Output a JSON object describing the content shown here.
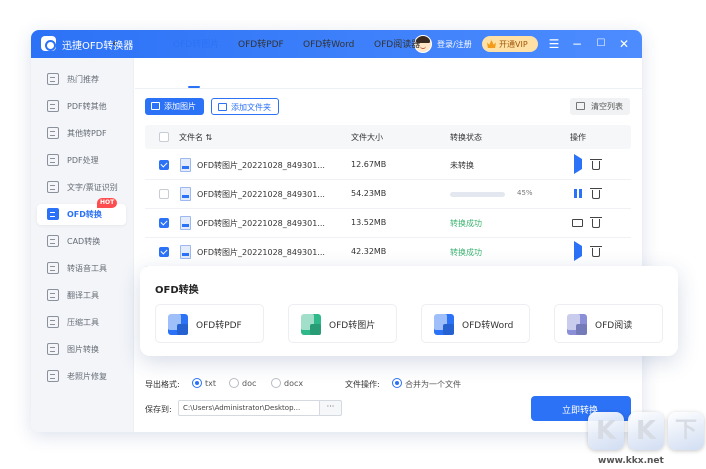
{
  "app": {
    "title": "迅捷OFD转换器",
    "login_text": "登录/注册",
    "vip_label": "开通VIP",
    "window_controls": [
      "menu-icon",
      "minimize-icon",
      "maximize-icon",
      "close-icon"
    ]
  },
  "sidebar": {
    "items": [
      {
        "label": "热门推荐",
        "icon": "star-icon",
        "active": false
      },
      {
        "label": "PDF转其他",
        "icon": "pdf-icon",
        "active": false
      },
      {
        "label": "其他转PDF",
        "icon": "convert-icon",
        "active": false
      },
      {
        "label": "PDF处理",
        "icon": "tools-icon",
        "active": false
      },
      {
        "label": "文字/票证识别",
        "icon": "ocr-icon",
        "active": false
      },
      {
        "label": "OFD转换",
        "icon": "ofd-icon",
        "active": true,
        "badge": "HOT"
      },
      {
        "label": "CAD转换",
        "icon": "cad-icon",
        "active": false
      },
      {
        "label": "转语音工具",
        "icon": "voice-icon",
        "active": false
      },
      {
        "label": "翻译工具",
        "icon": "translate-icon",
        "active": false
      },
      {
        "label": "压缩工具",
        "icon": "compress-icon",
        "active": false
      },
      {
        "label": "图片转换",
        "icon": "image-icon",
        "active": false
      },
      {
        "label": "老照片修复",
        "icon": "photo-icon",
        "active": false
      }
    ]
  },
  "tabs": [
    {
      "label": "OFD转图片",
      "active": true
    },
    {
      "label": "OFD转PDF",
      "active": false
    },
    {
      "label": "OFD转Word",
      "active": false
    },
    {
      "label": "OFD阅读器",
      "active": false
    }
  ],
  "toolbar": {
    "add_image": "添加图片",
    "add_folder": "添加文件夹",
    "clear_list": "清空列表"
  },
  "table": {
    "headers": {
      "name": "文件名 ⇅",
      "size": "文件大小",
      "status": "转换状态",
      "action": "操作"
    },
    "rows": [
      {
        "checked": true,
        "name": "OFD转图片_20221028_849301...",
        "size": "12.67MB",
        "status": "未转换",
        "status_type": "pending",
        "progress": null,
        "actions": [
          "play-icon",
          "trash-icon"
        ]
      },
      {
        "checked": false,
        "name": "OFD转图片_20221028_849301...",
        "size": "54.23MB",
        "status": "45%",
        "status_type": "progress",
        "progress": 0.45,
        "actions": [
          "pause-icon",
          "trash-icon"
        ]
      },
      {
        "checked": true,
        "name": "OFD转图片_20221028_849301...",
        "size": "13.52MB",
        "status": "转换成功",
        "status_type": "success",
        "progress": null,
        "actions": [
          "folder-icon",
          "trash-icon"
        ]
      },
      {
        "checked": true,
        "name": "OFD转图片_20221028_849301...",
        "size": "42.32MB",
        "status": "转换成功",
        "status_type": "success",
        "progress": null,
        "actions": [
          "play-icon",
          "trash-icon"
        ]
      }
    ]
  },
  "popup": {
    "title": "OFD转换",
    "cards": [
      {
        "label": "OFD转PDF",
        "color": "#2c72f6"
      },
      {
        "label": "OFD转图片",
        "color": "#2fb98a"
      },
      {
        "label": "OFD转Word",
        "color": "#2c72f6"
      },
      {
        "label": "OFD阅读",
        "color": "#8a8fd8"
      }
    ]
  },
  "footer": {
    "format_label": "导出格式:",
    "formats": [
      {
        "label": "txt",
        "selected": true
      },
      {
        "label": "doc",
        "selected": false
      },
      {
        "label": "docx",
        "selected": false
      }
    ],
    "file_op_label": "文件操作:",
    "file_op_option": "合并为一个文件",
    "save_label": "保存到:",
    "save_path": "C:\\Users\\Administrator\\Desktop...",
    "browse": "···",
    "convert": "立即转换"
  },
  "watermark": {
    "letters": [
      "K",
      "K",
      "下"
    ],
    "url": "www.kkx.net"
  }
}
